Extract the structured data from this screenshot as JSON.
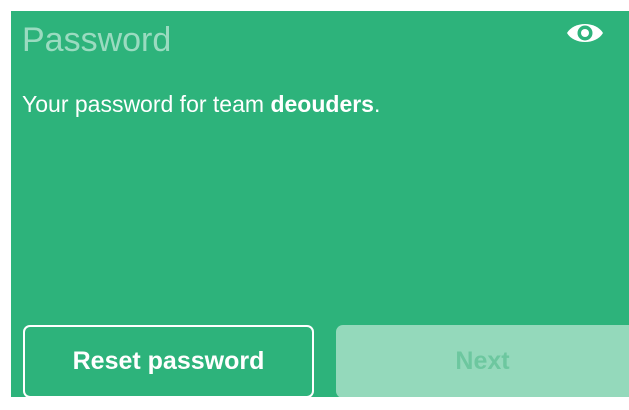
{
  "password": {
    "placeholder": "Password",
    "value": "",
    "visibility_toggle_icon": "eye-icon"
  },
  "message": {
    "prefix": "Your password for team ",
    "team": "deouders",
    "suffix": "."
  },
  "actions": {
    "reset_label": "Reset password",
    "next_label": "Next",
    "next_enabled": false
  },
  "colors": {
    "panel_background": "#2db37b",
    "text": "#ffffff",
    "next_background_disabled": "#94d9bb",
    "next_text_disabled": "#6dc79f"
  }
}
